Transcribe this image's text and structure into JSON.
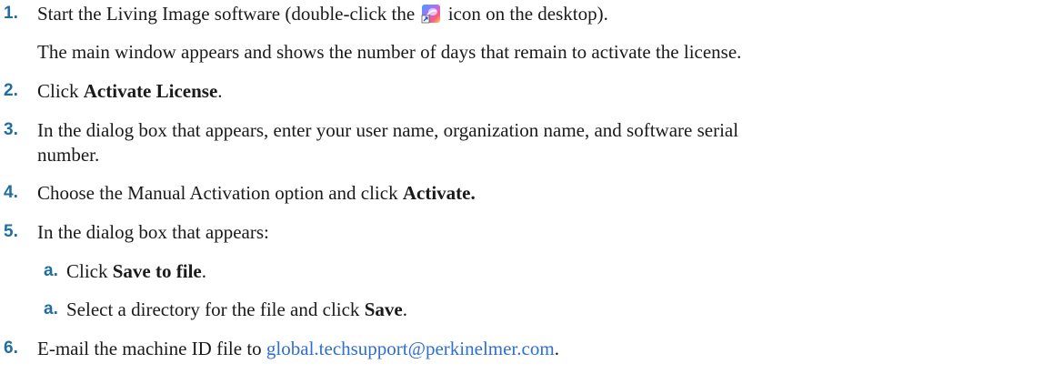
{
  "steps": [
    {
      "num": "1.",
      "pre": "Start the Living Image software (double-click the",
      "icon": "living-image-icon",
      "post": "icon on the desktop).",
      "continuation": "The main window appears and shows the number of days that remain to activate the license."
    },
    {
      "num": "2.",
      "pre": "Click ",
      "bold": "Activate License",
      "post": "."
    },
    {
      "num": "3.",
      "text": "In the dialog box that appears, enter your user name, organization name, and software serial",
      "continuation": "number."
    },
    {
      "num": "4.",
      "pre": "Choose the Manual Activation option and click ",
      "bold": "Activate."
    },
    {
      "num": "5.",
      "text": "In the dialog box that appears:"
    },
    {
      "num": "a.",
      "pre": "Click ",
      "bold": "Save to file",
      "post": "."
    },
    {
      "num": "a.",
      "pre": "Select a directory for the file and click ",
      "bold": "Save",
      "post": "."
    },
    {
      "num": "6.",
      "pre": "E-mail the machine ID file to ",
      "link": "global.techsupport@perkinelmer.com",
      "post": "."
    }
  ],
  "colors": {
    "step_number": "#1f6ea0",
    "link": "#2e6fd1",
    "text": "#1a1a1a"
  }
}
